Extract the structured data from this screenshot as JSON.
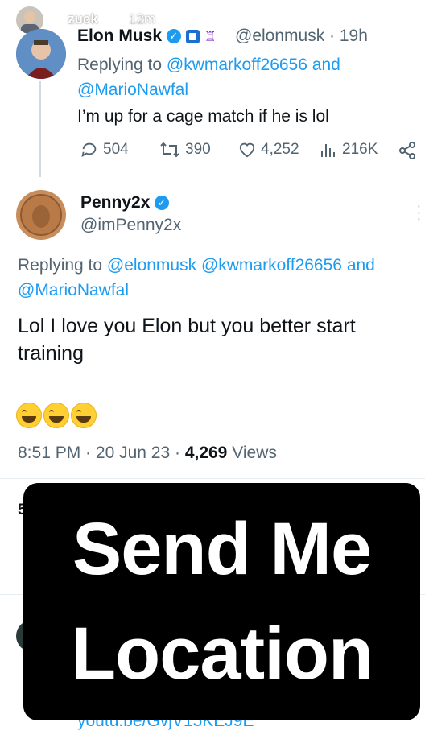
{
  "story": {
    "username": "zuck",
    "time": "12m"
  },
  "tweet1": {
    "name": "Elon Musk",
    "handle": "@elonmusk",
    "age": "19h",
    "replying_prefix": "Replying to",
    "replying_to": [
      "@kwmarkoff26656",
      "@MarioNawfal"
    ],
    "and": "and",
    "text": "I’m up for a cage match if he is lol",
    "stats": {
      "replies": "504",
      "retweets": "390",
      "likes": "4,252",
      "views": "216K"
    }
  },
  "tweet2": {
    "name": "Penny2x",
    "handle": "@imPenny2x",
    "replying_prefix": "Replying to",
    "replying_to": [
      "@elonmusk",
      "@kwmarkoff26656",
      "@MarioNawfal"
    ],
    "and": "and",
    "text": "Lol I love you Elon but you better start training",
    "time": "8:51 PM",
    "date": "20 Jun 23",
    "views_count": "4,269",
    "views_label": "Views",
    "next_section_partial": "5"
  },
  "ghost_link": "youtu.be/GvjV15KEJ9E",
  "sticker": {
    "line1": "Send Me",
    "line2": "Location"
  },
  "colors": {
    "link": "#1d9bf0",
    "verified": "#1d9bf0",
    "sticker_bg": "#000000"
  }
}
